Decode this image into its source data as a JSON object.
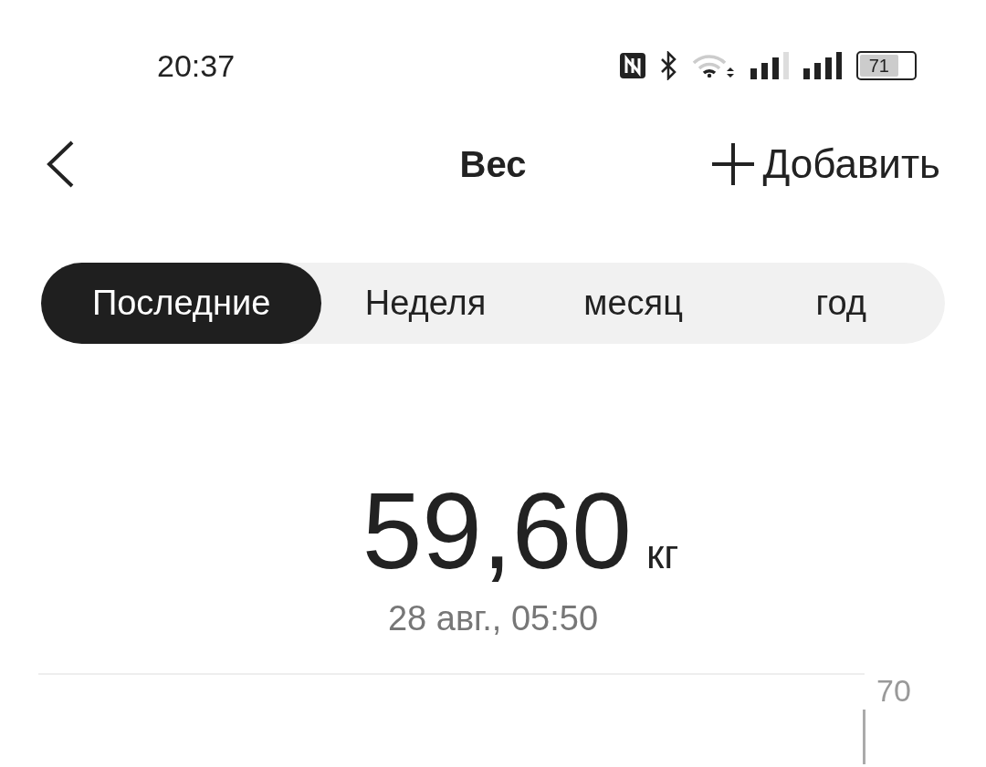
{
  "status_bar": {
    "time": "20:37",
    "battery": "71"
  },
  "header": {
    "title": "Вес",
    "add_label": "Добавить"
  },
  "tabs": [
    {
      "label": "Последние",
      "selected": true
    },
    {
      "label": "Неделя",
      "selected": false
    },
    {
      "label": "месяц",
      "selected": false
    },
    {
      "label": "год",
      "selected": false
    }
  ],
  "reading": {
    "value": "59,60",
    "unit": "кг",
    "date": "28 авг., 05:50"
  },
  "chart": {
    "axis_label": "70"
  }
}
